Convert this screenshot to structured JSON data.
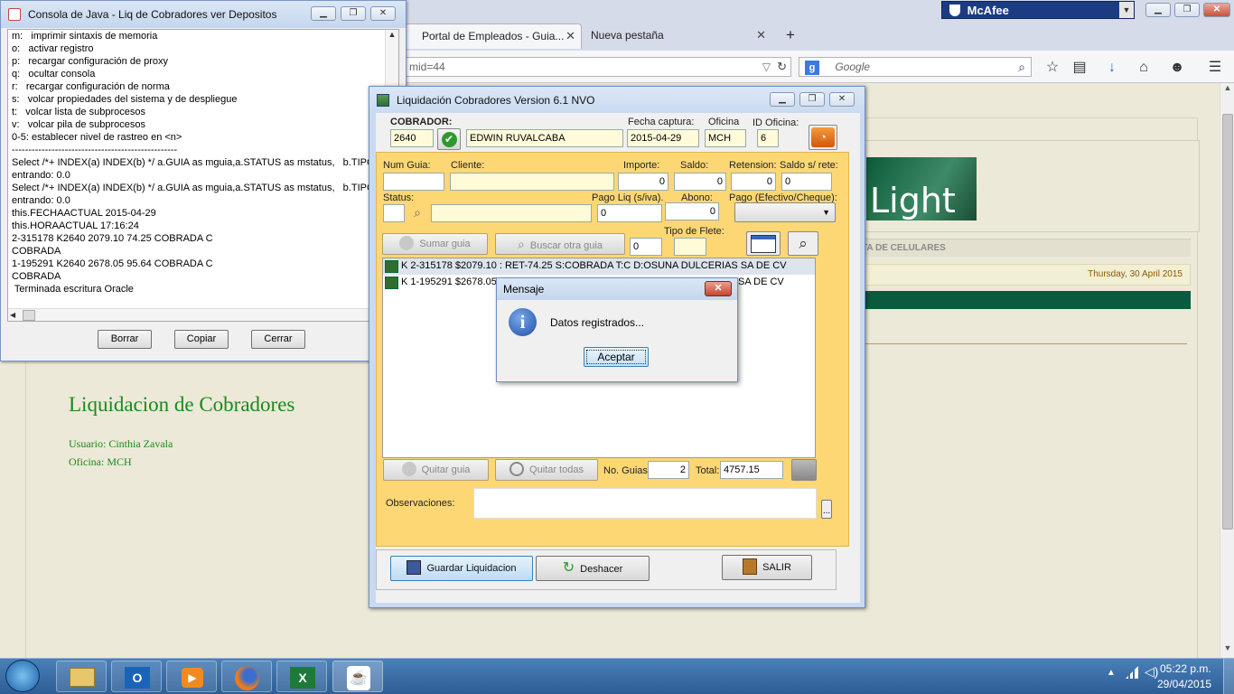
{
  "browser": {
    "mcafee_label": "McAfee",
    "tabs": [
      {
        "label": "Portal de Empleados - Guia..."
      },
      {
        "label": "Nueva pestaña"
      }
    ],
    "new_tab": "+",
    "url": "mid=44",
    "search_placeholder": "Google",
    "page": {
      "logo_text": "Light",
      "banner_text": "TA DE CELULARES",
      "date": "Thursday, 30 April 2015",
      "heading": "Liquidacion de Cobradores",
      "user_line": "Usuario: Cinthia Zavala",
      "office_line": "Oficina: MCH"
    }
  },
  "console": {
    "title": "Consola de Java - Liq de Cobradores ver Depositos",
    "lines": [
      "m:   imprimir sintaxis de memoria",
      "o:   activar registro",
      "p:   recargar configuración de proxy",
      "q:   ocultar consola",
      "r:   recargar configuración de norma",
      "s:   volcar propiedades del sistema y de despliegue",
      "t:   volcar lista de subprocesos",
      "v:   volcar pila de subprocesos",
      "0-5: establecer nivel de rastreo en <n>",
      "--------------------------------------------------",
      "",
      "Select /*+ INDEX(a) INDEX(b) */ a.GUIA as mguia,a.STATUS as mstatus,   b.TIPO",
      "entrando: 0.0",
      "Select /*+ INDEX(a) INDEX(b) */ a.GUIA as mguia,a.STATUS as mstatus,   b.TIPO",
      "entrando: 0.0",
      "this.FECHAACTUAL 2015-04-29",
      "this.HORAACTUAL 17:16:24",
      "2-315178 K2640 2079.10 74.25 COBRADA C",
      "COBRADA",
      "1-195291 K2640 2678.05 95.64 COBRADA C",
      "COBRADA",
      " Terminada escritura Oracle"
    ],
    "buttons": {
      "clear": "Borrar",
      "copy": "Copiar",
      "close": "Cerrar"
    }
  },
  "liq": {
    "title": "Liquidación Cobradores Version 6.1 NVO",
    "cobrador_label": "COBRADOR:",
    "cobrador_id": "2640",
    "cobrador_name": "EDWIN RUVALCABA",
    "fecha_label": "Fecha captura:",
    "fecha": "2015-04-29",
    "oficina_label": "Oficina",
    "oficina": "MCH",
    "idoficina_label": "ID Oficina:",
    "idoficina": "6",
    "numguia_label": "Num Guia:",
    "cliente_label": "Cliente:",
    "importe_label": "Importe:",
    "importe": "0",
    "saldo_label": "Saldo:",
    "saldo": "0",
    "retension_label": "Retension:",
    "retension": "0",
    "saldorete_label": "Saldo s/ rete:",
    "saldorete": "0",
    "status_label": "Status:",
    "pagoliq_label": "Pago Liq (s/iva).",
    "pagoliq": "0",
    "abono_label": "Abono:",
    "abono": "0",
    "pago_label": "Pago (Efectivo/Cheque):",
    "sumar": "Sumar guia",
    "buscar": "Buscar otra guia",
    "flete_value": "0",
    "flete_label": "Tipo de Flete:",
    "rows": [
      "K 2-315178 $2079.10 : RET-74.25  S:COBRADA  T:C  D:OSUNA DULCERIAS SA DE CV",
      "K 1-195291 $2678.05"
    ],
    "row2_tail": "SA DE CV",
    "quitar": "Quitar guia",
    "quitar_todas": "Quitar todas",
    "noguias_label": "No. Guias",
    "noguias": "2",
    "total_label": "Total:",
    "total": "4757.15",
    "obs_label": "Observaciones:",
    "obs_more": "...",
    "guardar": "Guardar Liquidacion",
    "deshacer": "Deshacer",
    "salir": "SALIR"
  },
  "dialog": {
    "title": "Mensaje",
    "message": "Datos registrados...",
    "ok": "Aceptar"
  },
  "taskbar": {
    "time": "05:22 p.m.",
    "date": "29/04/2015"
  }
}
